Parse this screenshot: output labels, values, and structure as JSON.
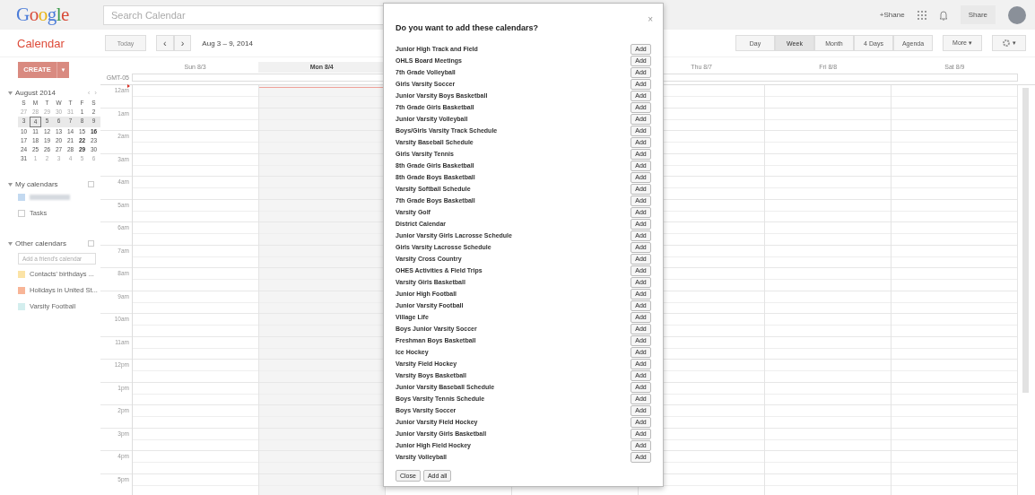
{
  "topbar": {
    "logo": "Google",
    "search": {
      "placeholder": "Search Calendar"
    },
    "user_link": "+Shane",
    "share": "Share"
  },
  "toolbar": {
    "app_title": "Calendar",
    "today": {
      "label": "Today",
      "disabled": true
    },
    "prev": "‹",
    "next": "›",
    "range": "Aug 3 – 9, 2014",
    "views": [
      {
        "label": "Day",
        "selected": false
      },
      {
        "label": "Week",
        "selected": true
      },
      {
        "label": "Month",
        "selected": false
      },
      {
        "label": "4 Days",
        "selected": false
      },
      {
        "label": "Agenda",
        "selected": false
      }
    ],
    "more": "More ▾",
    "settings_caret": "▾"
  },
  "sidebar": {
    "create": "CREATE",
    "create_caret": "▼",
    "month": "August 2014",
    "prev": "‹",
    "next": "›",
    "weekdays": [
      "S",
      "M",
      "T",
      "W",
      "T",
      "F",
      "S"
    ],
    "weeks": [
      {
        "selected": false,
        "days": [
          {
            "d": "27",
            "muted": true,
            "bold": false,
            "today": false
          },
          {
            "d": "28",
            "muted": true,
            "bold": false,
            "today": false
          },
          {
            "d": "29",
            "muted": true,
            "bold": false,
            "today": false
          },
          {
            "d": "30",
            "muted": true,
            "bold": false,
            "today": false
          },
          {
            "d": "31",
            "muted": true,
            "bold": false,
            "today": false
          },
          {
            "d": "1",
            "muted": false,
            "bold": false,
            "today": false
          },
          {
            "d": "2",
            "muted": false,
            "bold": false,
            "today": false
          }
        ]
      },
      {
        "selected": true,
        "days": [
          {
            "d": "3",
            "muted": false,
            "bold": false,
            "today": false
          },
          {
            "d": "4",
            "muted": false,
            "bold": false,
            "today": true
          },
          {
            "d": "5",
            "muted": false,
            "bold": false,
            "today": false
          },
          {
            "d": "6",
            "muted": false,
            "bold": false,
            "today": false
          },
          {
            "d": "7",
            "muted": false,
            "bold": false,
            "today": false
          },
          {
            "d": "8",
            "muted": false,
            "bold": false,
            "today": false
          },
          {
            "d": "9",
            "muted": false,
            "bold": false,
            "today": false
          }
        ]
      },
      {
        "selected": false,
        "days": [
          {
            "d": "10",
            "muted": false,
            "bold": false,
            "today": false
          },
          {
            "d": "11",
            "muted": false,
            "bold": false,
            "today": false
          },
          {
            "d": "12",
            "muted": false,
            "bold": false,
            "today": false
          },
          {
            "d": "13",
            "muted": false,
            "bold": false,
            "today": false
          },
          {
            "d": "14",
            "muted": false,
            "bold": false,
            "today": false
          },
          {
            "d": "15",
            "muted": false,
            "bold": false,
            "today": false
          },
          {
            "d": "16",
            "muted": false,
            "bold": true,
            "today": false
          }
        ]
      },
      {
        "selected": false,
        "days": [
          {
            "d": "17",
            "muted": false,
            "bold": false,
            "today": false
          },
          {
            "d": "18",
            "muted": false,
            "bold": false,
            "today": false
          },
          {
            "d": "19",
            "muted": false,
            "bold": false,
            "today": false
          },
          {
            "d": "20",
            "muted": false,
            "bold": false,
            "today": false
          },
          {
            "d": "21",
            "muted": false,
            "bold": false,
            "today": false
          },
          {
            "d": "22",
            "muted": false,
            "bold": true,
            "today": false
          },
          {
            "d": "23",
            "muted": false,
            "bold": false,
            "today": false
          }
        ]
      },
      {
        "selected": false,
        "days": [
          {
            "d": "24",
            "muted": false,
            "bold": false,
            "today": false
          },
          {
            "d": "25",
            "muted": false,
            "bold": false,
            "today": false
          },
          {
            "d": "26",
            "muted": false,
            "bold": false,
            "today": false
          },
          {
            "d": "27",
            "muted": false,
            "bold": false,
            "today": false
          },
          {
            "d": "28",
            "muted": false,
            "bold": false,
            "today": false
          },
          {
            "d": "29",
            "muted": false,
            "bold": true,
            "today": false
          },
          {
            "d": "30",
            "muted": false,
            "bold": false,
            "today": false
          }
        ]
      },
      {
        "selected": false,
        "days": [
          {
            "d": "31",
            "muted": false,
            "bold": false,
            "today": false
          },
          {
            "d": "1",
            "muted": true,
            "bold": false,
            "today": false
          },
          {
            "d": "2",
            "muted": true,
            "bold": false,
            "today": false
          },
          {
            "d": "3",
            "muted": true,
            "bold": false,
            "today": false
          },
          {
            "d": "4",
            "muted": true,
            "bold": false,
            "today": false
          },
          {
            "d": "5",
            "muted": true,
            "bold": false,
            "today": false
          },
          {
            "d": "6",
            "muted": true,
            "bold": false,
            "today": false
          }
        ]
      }
    ],
    "my_calendars": {
      "title": "My calendars",
      "items": [
        {
          "kind": "redacted",
          "color": "#c3d9f0"
        },
        {
          "kind": "named",
          "name": "Tasks",
          "color": "#ffffff"
        }
      ]
    },
    "other_calendars": {
      "title": "Other calendars",
      "add_placeholder": "Add a friend's calendar",
      "items": [
        {
          "kind": "named",
          "name": "Contacts' birthdays ...",
          "color": "#fbe3a6"
        },
        {
          "kind": "named",
          "name": "Holidays in United St...",
          "color": "#f8b597"
        },
        {
          "kind": "named",
          "name": "Varsity Football",
          "color": "#d3eeee"
        }
      ]
    }
  },
  "grid": {
    "timezone": "GMT-05",
    "days": [
      {
        "label": "Sun 8/3",
        "today": false
      },
      {
        "label": "Mon 8/4",
        "today": true
      },
      {
        "label": "Thu 8/7",
        "today": false
      },
      {
        "label": "Fri 8/8",
        "today": false
      },
      {
        "label": "Sat 8/9",
        "today": false
      }
    ],
    "hours": [
      "12am",
      "1am",
      "2am",
      "3am",
      "4am",
      "5am",
      "6am",
      "7am",
      "8am",
      "9am",
      "10am",
      "11am",
      "12pm",
      "1pm",
      "2pm",
      "3pm",
      "4pm",
      "5pm"
    ]
  },
  "dialog": {
    "title": "Do you want to add these calendars?",
    "close": "×",
    "calendars": [
      {
        "name": "Junior High Track and Field",
        "add": "Add"
      },
      {
        "name": "OHLS Board Meetings",
        "add": "Add"
      },
      {
        "name": "7th Grade Volleyball",
        "add": "Add"
      },
      {
        "name": "Girls Varsity Soccer",
        "add": "Add"
      },
      {
        "name": "Junior Varsity Boys Basketball",
        "add": "Add"
      },
      {
        "name": "7th Grade Girls Basketball",
        "add": "Add"
      },
      {
        "name": "Junior Varsity Volleyball",
        "add": "Add"
      },
      {
        "name": "Boys/Girls Varsity Track Schedule",
        "add": "Add"
      },
      {
        "name": "Varsity Baseball Schedule",
        "add": "Add"
      },
      {
        "name": "Girls Varsity Tennis",
        "add": "Add"
      },
      {
        "name": "8th Grade Girls Basketball",
        "add": "Add"
      },
      {
        "name": "8th Grade Boys Basketball",
        "add": "Add"
      },
      {
        "name": "Varsity Softball Schedule",
        "add": "Add"
      },
      {
        "name": "7th Grade Boys Basketball",
        "add": "Add"
      },
      {
        "name": "Varsity Golf",
        "add": "Add"
      },
      {
        "name": "District Calendar",
        "add": "Add"
      },
      {
        "name": "Junior Varsity Girls Lacrosse Schedule",
        "add": "Add"
      },
      {
        "name": "Girls Varsity Lacrosse Schedule",
        "add": "Add"
      },
      {
        "name": "Varsity Cross Country",
        "add": "Add"
      },
      {
        "name": "OHES Activities & Field Trips",
        "add": "Add"
      },
      {
        "name": "Varsity Girls Basketball",
        "add": "Add"
      },
      {
        "name": "Junior High Football",
        "add": "Add"
      },
      {
        "name": "Junior Varsity Football",
        "add": "Add"
      },
      {
        "name": "Village Life",
        "add": "Add"
      },
      {
        "name": "Boys Junior Varsity Soccer",
        "add": "Add"
      },
      {
        "name": "Freshman Boys Basketball",
        "add": "Add"
      },
      {
        "name": "Ice Hockey",
        "add": "Add"
      },
      {
        "name": "Varsity Field Hockey",
        "add": "Add"
      },
      {
        "name": "Varsity Boys Basketball",
        "add": "Add"
      },
      {
        "name": "Junior Varsity Baseball Schedule",
        "add": "Add"
      },
      {
        "name": "Boys Varsity Tennis Schedule",
        "add": "Add"
      },
      {
        "name": "Boys Varsity Soccer",
        "add": "Add"
      },
      {
        "name": "Junior Varsity Field Hockey",
        "add": "Add"
      },
      {
        "name": "Junior Varsity Girls Basketball",
        "add": "Add"
      },
      {
        "name": "Junior High Field Hockey",
        "add": "Add"
      },
      {
        "name": "Varsity Volleyball",
        "add": "Add"
      }
    ],
    "buttons": [
      "Close",
      "Add all"
    ]
  }
}
